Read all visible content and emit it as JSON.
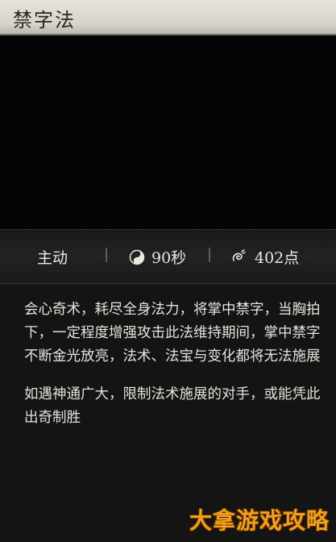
{
  "header": {
    "title": "禁字法"
  },
  "stats": {
    "type": "主动",
    "cooldown": "90秒",
    "cost": "402点",
    "separator": "|",
    "cooldown_icon": "yin-yang-icon",
    "cost_icon": "swirl-mana-icon"
  },
  "description": {
    "paragraph1": "会心奇术，耗尽全身法力，将掌中禁字，当胸拍下，一定程度增强攻击此法维持期间，掌中禁字不断金光放亮，法术、法宝与变化都将无法施展",
    "paragraph2": "如遇神通广大，限制法术施展的对手，或能凭此出奇制胜"
  },
  "watermark": {
    "text": "大拿游戏攻略"
  },
  "colors": {
    "title_bar": "#dcd8d0",
    "background": "#141414",
    "text": "#e8e4dc",
    "watermark": "#f0a020"
  }
}
